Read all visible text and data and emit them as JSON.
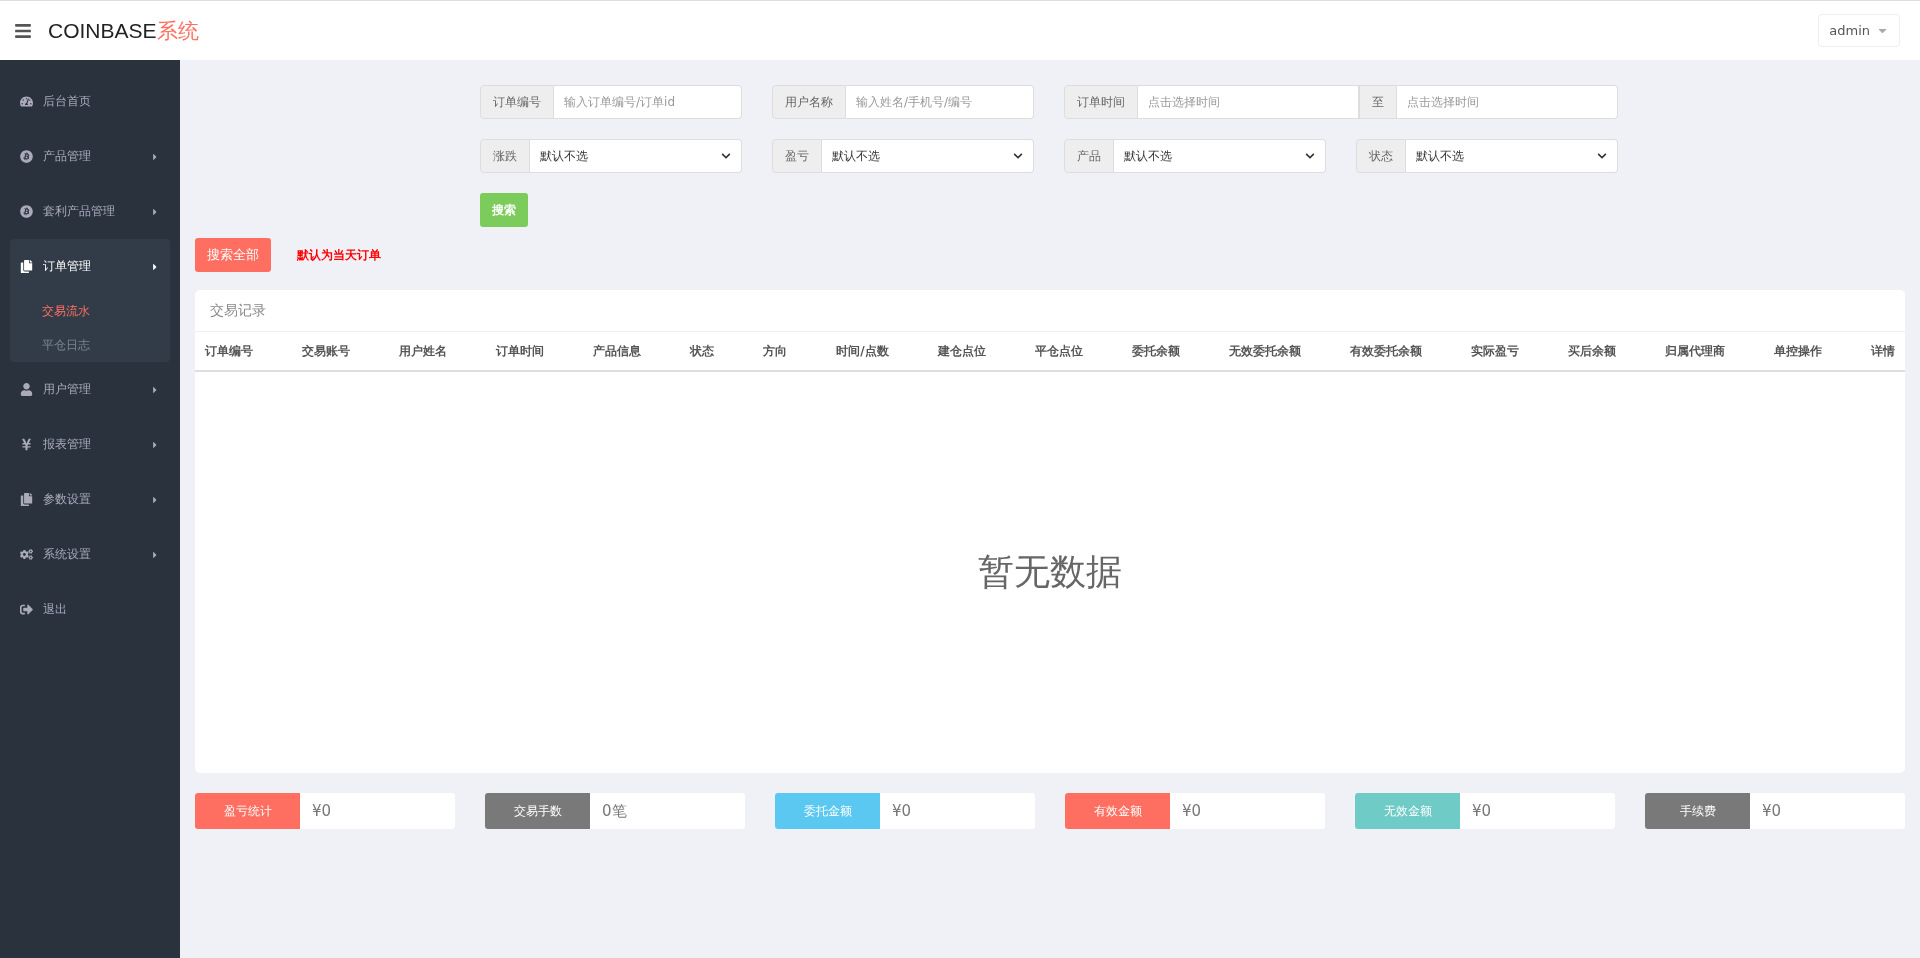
{
  "header": {
    "brand": "COINBASE",
    "brand_suffix": "系统",
    "user": "admin"
  },
  "sidebar": {
    "items": [
      {
        "kind": "link",
        "label": "后台首页"
      },
      {
        "kind": "group",
        "label": "产品管理",
        "expanded": false
      },
      {
        "kind": "group",
        "label": "套利产品管理",
        "expanded": false
      },
      {
        "kind": "group",
        "label": "订单管理",
        "expanded": true,
        "children": [
          {
            "label": "交易流水",
            "selected": true
          },
          {
            "label": "平仓日志",
            "selected": false
          }
        ]
      },
      {
        "kind": "group",
        "label": "用户管理",
        "expanded": false
      },
      {
        "kind": "group",
        "label": "报表管理",
        "expanded": false
      },
      {
        "kind": "group",
        "label": "参数设置",
        "expanded": false
      },
      {
        "kind": "group",
        "label": "系统设置",
        "expanded": false
      },
      {
        "kind": "link",
        "label": "退出"
      }
    ]
  },
  "filters": {
    "text_fields": [
      {
        "kind": "text",
        "label": "订单编号",
        "placeholder": "输入订单编号/订单id"
      },
      {
        "kind": "text",
        "label": "用户名称",
        "placeholder": "输入姓名/手机号/编号"
      },
      {
        "kind": "range",
        "label": "订单时间",
        "placeholder": "点击选择时间",
        "separator": "至",
        "placeholder_end": "点击选择时间"
      }
    ],
    "selects": [
      {
        "label": "涨跌",
        "value": "默认不选"
      },
      {
        "label": "盈亏",
        "value": "默认不选"
      },
      {
        "label": "产品",
        "value": "默认不选"
      },
      {
        "label": "状态",
        "value": "默认不选"
      }
    ],
    "search_button": "搜索"
  },
  "search_all_button": "搜索全部",
  "note": "默认为当天订单",
  "table": {
    "title": "交易记录",
    "columns": [
      "订单编号",
      "交易账号",
      "用户姓名",
      "订单时间",
      "产品信息",
      "状态",
      "方向",
      "时间/点数",
      "建仓点位",
      "平仓点位",
      "委托余额",
      "无效委托余额",
      "有效委托余额",
      "实际盈亏",
      "买后余额",
      "归属代理商",
      "单控操作",
      "详情"
    ],
    "empty_text": "暂无数据"
  },
  "stats": [
    {
      "label": "盈亏统计",
      "value": "¥0",
      "color": "#ff6f61"
    },
    {
      "label": "交易手数",
      "value": "0笔",
      "color": "#797979"
    },
    {
      "label": "委托金额",
      "value": "¥0",
      "color": "#5bc8f2"
    },
    {
      "label": "有效金额",
      "value": "¥0",
      "color": "#ff6f61"
    },
    {
      "label": "无效金额",
      "value": "¥0",
      "color": "#6ecbc6"
    },
    {
      "label": "手续费",
      "value": "¥0",
      "color": "#797979"
    }
  ]
}
